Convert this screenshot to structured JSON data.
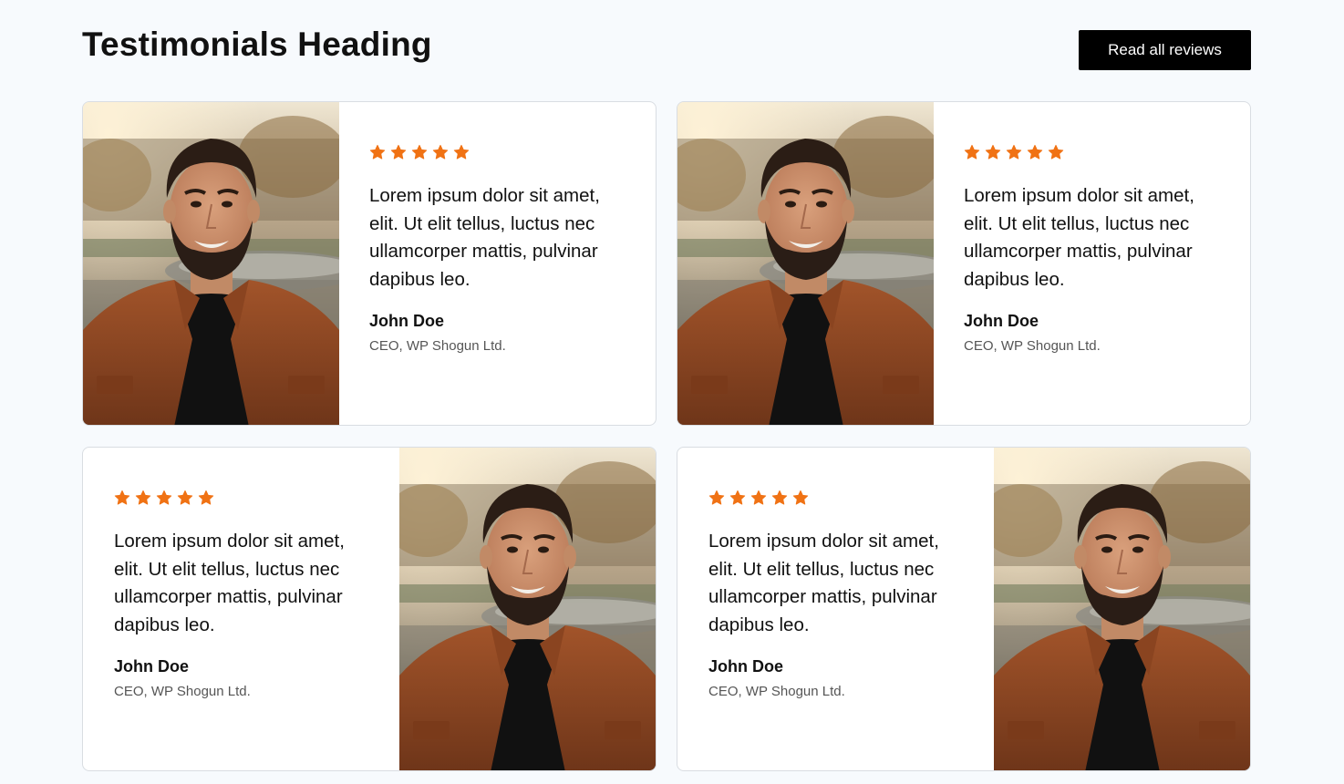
{
  "header": {
    "title": "Testimonials Heading",
    "cta_label": "Read all reviews"
  },
  "colors": {
    "star": "#f07214",
    "button_bg": "#000000",
    "page_bg": "#f7fafd"
  },
  "testimonials": [
    {
      "rating": 5,
      "quote": "Lorem ipsum dolor sit amet, elit. Ut elit tellus, luctus nec ullamcorper mattis, pulvinar dapibus leo.",
      "name": "John Doe",
      "role": "CEO, WP Shogun Ltd.",
      "image_position": "left"
    },
    {
      "rating": 5,
      "quote": "Lorem ipsum dolor sit amet, elit. Ut elit tellus, luctus nec ullamcorper mattis, pulvinar dapibus leo.",
      "name": "John Doe",
      "role": "CEO, WP Shogun Ltd.",
      "image_position": "left"
    },
    {
      "rating": 5,
      "quote": "Lorem ipsum dolor sit amet, elit. Ut elit tellus, luctus nec ullamcorper mattis, pulvinar dapibus leo.",
      "name": "John Doe",
      "role": "CEO, WP Shogun Ltd.",
      "image_position": "right"
    },
    {
      "rating": 5,
      "quote": "Lorem ipsum dolor sit amet, elit. Ut elit tellus, luctus nec ullamcorper mattis, pulvinar dapibus leo.",
      "name": "John Doe",
      "role": "CEO, WP Shogun Ltd.",
      "image_position": "right"
    }
  ]
}
